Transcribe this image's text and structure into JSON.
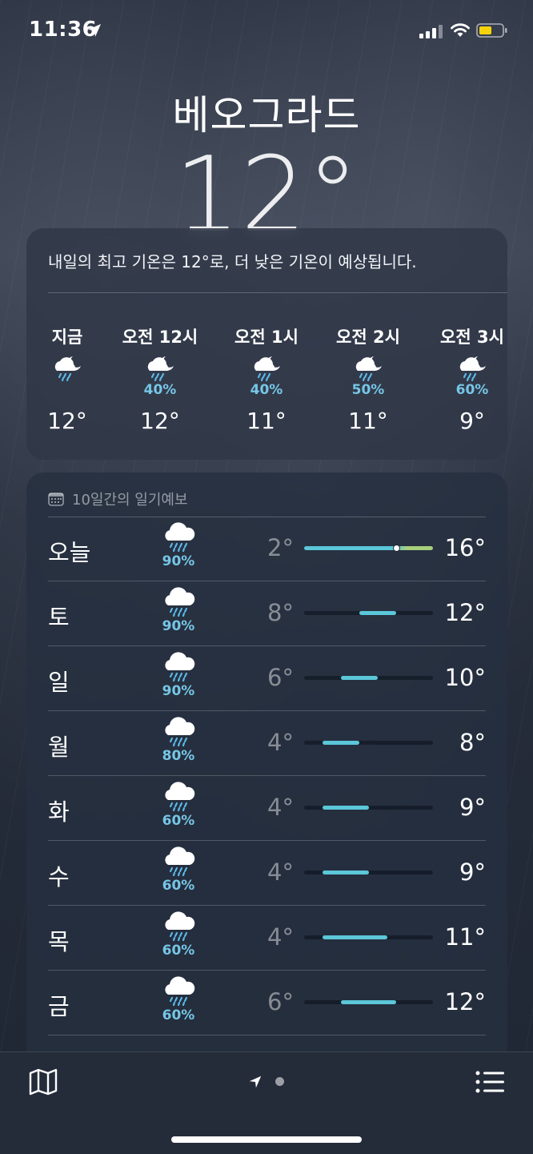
{
  "status_bar": {
    "time": "11:36",
    "location_icon": "location-arrow-icon",
    "signal_icon": "cellular-signal-icon",
    "wifi_icon": "wifi-icon",
    "battery_icon": "battery-icon",
    "battery_color": "#f5d30b"
  },
  "location": {
    "city": "베오그라드",
    "current_temp": "12°"
  },
  "hourly": {
    "summary": "내일의 최고 기온은 12°로, 더 낮은 기온이 예상됩니다.",
    "items": [
      {
        "label": "지금",
        "icon": "night-rain-icon",
        "pop": "",
        "temp": "12°"
      },
      {
        "label": "오전 12시",
        "icon": "night-rain-icon",
        "pop": "40%",
        "temp": "12°"
      },
      {
        "label": "오전 1시",
        "icon": "night-rain-icon",
        "pop": "40%",
        "temp": "11°"
      },
      {
        "label": "오전 2시",
        "icon": "night-rain-icon",
        "pop": "50%",
        "temp": "11°"
      },
      {
        "label": "오전 3시",
        "icon": "night-rain-icon",
        "pop": "60%",
        "temp": "9°"
      }
    ]
  },
  "daily": {
    "header": "10일간의 일기예보",
    "header_icon": "calendar-icon",
    "range_min": 2,
    "range_max": 16,
    "current_temp_value": 12,
    "bar_color": "#5bc7d9",
    "warm_color": "#a7d07a",
    "rows": [
      {
        "day": "오늘",
        "icon": "rain-cloud-icon",
        "pop": "90%",
        "lo": "2°",
        "hi": "16°",
        "lo_v": 2,
        "hi_v": 16
      },
      {
        "day": "토",
        "icon": "rain-cloud-icon",
        "pop": "90%",
        "lo": "8°",
        "hi": "12°",
        "lo_v": 8,
        "hi_v": 12
      },
      {
        "day": "일",
        "icon": "rain-cloud-icon",
        "pop": "90%",
        "lo": "6°",
        "hi": "10°",
        "lo_v": 6,
        "hi_v": 10
      },
      {
        "day": "월",
        "icon": "rain-cloud-icon",
        "pop": "80%",
        "lo": "4°",
        "hi": "8°",
        "lo_v": 4,
        "hi_v": 8
      },
      {
        "day": "화",
        "icon": "rain-cloud-icon",
        "pop": "60%",
        "lo": "4°",
        "hi": "9°",
        "lo_v": 4,
        "hi_v": 9
      },
      {
        "day": "수",
        "icon": "rain-cloud-icon",
        "pop": "60%",
        "lo": "4°",
        "hi": "9°",
        "lo_v": 4,
        "hi_v": 9
      },
      {
        "day": "목",
        "icon": "rain-cloud-icon",
        "pop": "60%",
        "lo": "4°",
        "hi": "11°",
        "lo_v": 4,
        "hi_v": 11
      },
      {
        "day": "금",
        "icon": "rain-cloud-icon",
        "pop": "60%",
        "lo": "6°",
        "hi": "12°",
        "lo_v": 6,
        "hi_v": 12
      }
    ]
  },
  "tab_bar": {
    "map_icon": "map-icon",
    "location_page_icon": "location-arrow-icon",
    "page_dot": "page-indicator-dot",
    "list_icon": "list-icon"
  }
}
